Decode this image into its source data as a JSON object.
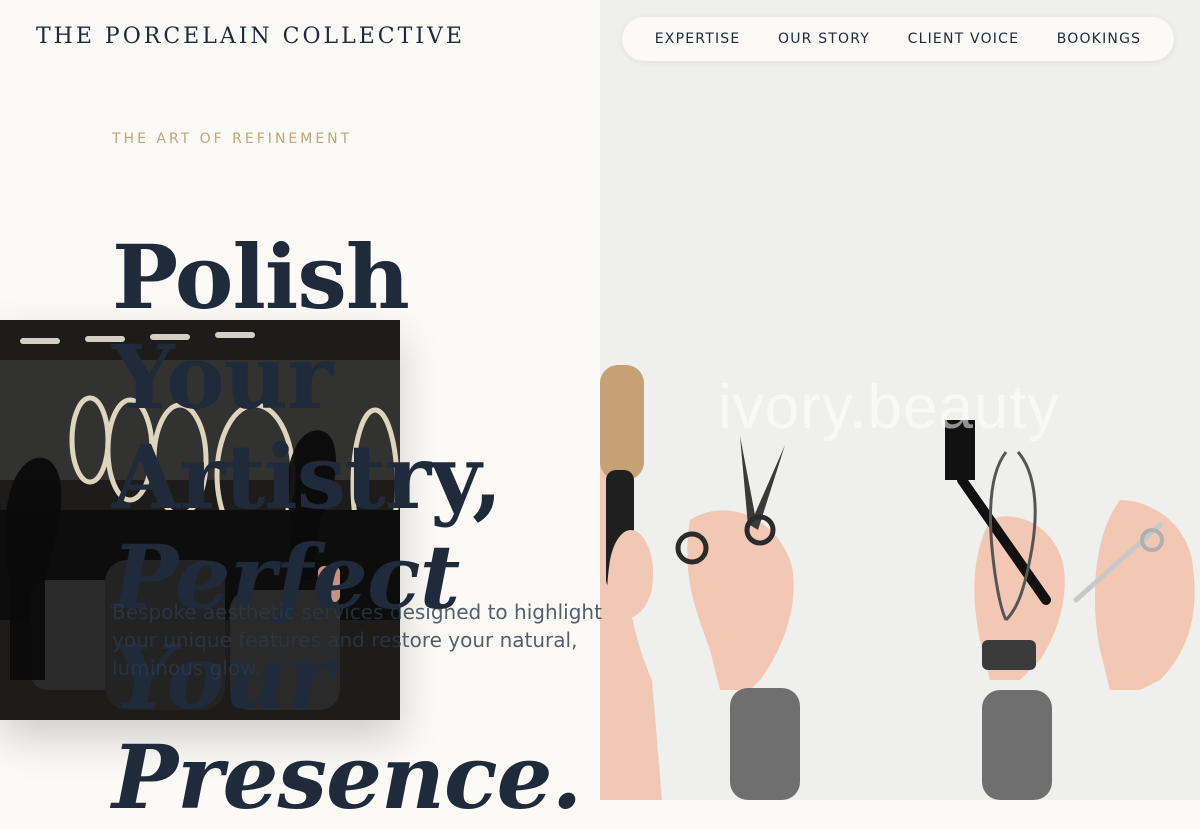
{
  "brand": "THE PORCELAIN COLLECTIVE",
  "nav": {
    "items": [
      "EXPERTISE",
      "OUR STORY",
      "CLIENT VOICE",
      "BOOKINGS"
    ]
  },
  "hero": {
    "eyebrow": "THE ART OF REFINEMENT",
    "headline": {
      "line1": "Polish Your",
      "line2": "Artistry,",
      "line3": "Perfect Your",
      "line4": "Presence."
    },
    "lede": "Bespoke aesthetic services designed to highlight your unique features and restore your natural, luminous glow."
  },
  "media": {
    "watermark": "ivory.beauty"
  },
  "colors": {
    "background": "#fbfaf7",
    "navy": "#1f2a3a",
    "gold": "#c1a77a"
  }
}
